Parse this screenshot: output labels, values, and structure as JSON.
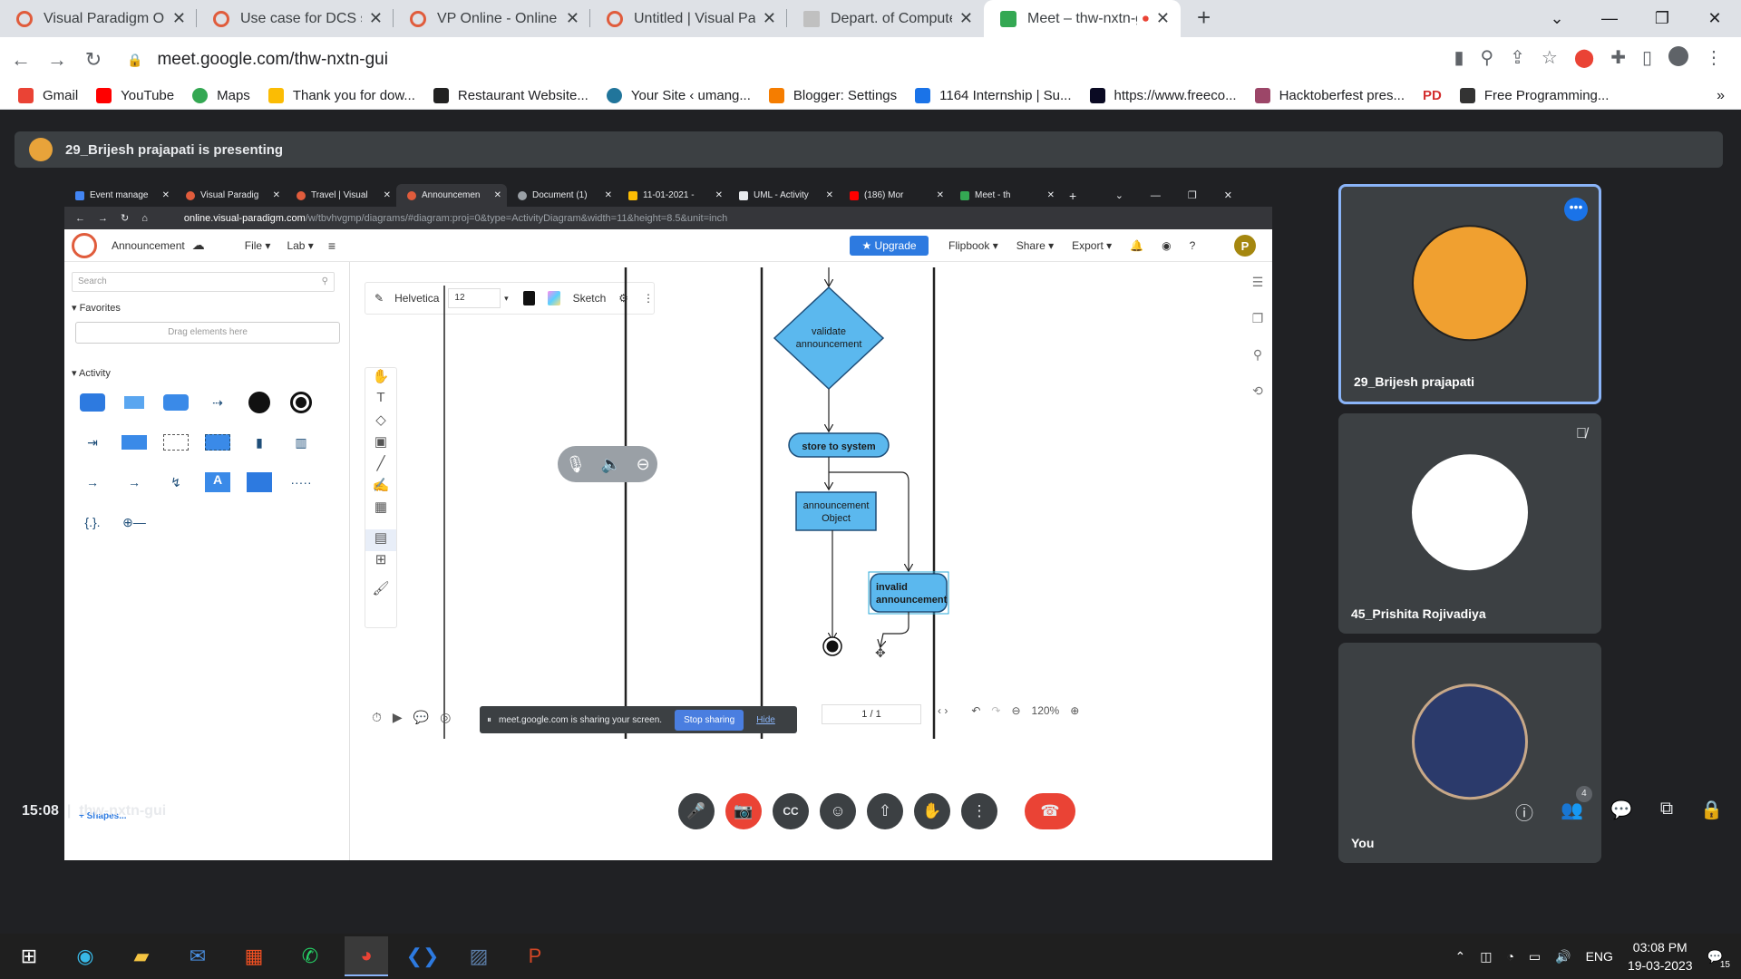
{
  "browser": {
    "tabs": [
      {
        "title": "Visual Paradigm Online",
        "color": "#e05c3c"
      },
      {
        "title": "Use case for DCS site.vpd | ",
        "color": "#e05c3c"
      },
      {
        "title": "VP Online - Online Drawing ",
        "color": "#e05c3c"
      },
      {
        "title": "Untitled | Visual Paradigm C",
        "color": "#e05c3c"
      },
      {
        "title": "Depart. of Computer scienc",
        "color": "#c0c0c0"
      },
      {
        "title": "Meet – thw-nxtn-gui",
        "color": "#34a853"
      }
    ],
    "url": "meet.google.com/thw-nxtn-gui",
    "bookmarks": [
      {
        "label": "Gmail",
        "color": "#ea4335"
      },
      {
        "label": "YouTube",
        "color": "#ff0000"
      },
      {
        "label": "Maps",
        "color": "#34a853"
      },
      {
        "label": "Thank you for dow...",
        "color": "#fbbc04"
      },
      {
        "label": "Restaurant Website...",
        "color": "#222222"
      },
      {
        "label": "Your Site ‹ umang...",
        "color": "#21759b"
      },
      {
        "label": "Blogger: Settings",
        "color": "#f57d00"
      },
      {
        "label": "1164 Internship | Su...",
        "color": "#1a73e8"
      },
      {
        "label": "https://www.freeco...",
        "color": "#0a0a23"
      },
      {
        "label": "Hacktoberfest pres...",
        "color": "#9c4668"
      },
      {
        "label": "PD",
        "color": "#d32f2f"
      },
      {
        "label": "Free Programming...",
        "color": "#333333"
      }
    ]
  },
  "meet": {
    "presenting": "29_Brijesh prajapati is presenting",
    "time": "15:08",
    "code": "thw-nxtn-gui",
    "participant_count": "4",
    "participants": [
      {
        "name": "29_Brijesh prajapati",
        "avatar_color": "#f0a030"
      },
      {
        "name": "45_Prishita Rojivadiya",
        "avatar_color": "#ffffff"
      },
      {
        "name": "You",
        "avatar_color": "#2b3a6b"
      }
    ]
  },
  "shared": {
    "inner_tabs": [
      "Event manage",
      "Visual Paradig",
      "Travel | Visual",
      "Announcemen",
      "Document (1)",
      "11-01-2021 -",
      "UML - Activity",
      "(186) Mor",
      "Meet - th"
    ],
    "inner_url_host": "online.visual-paradigm.com",
    "inner_url_path": "/w/tbvhvgmp/diagrams/#diagram:proj=0&type=ActivityDiagram&width=11&height=8.5&unit=inch",
    "doc_name": "Announcement",
    "menu": {
      "file": "File",
      "lab": "Lab"
    },
    "upgrade": "Upgrade",
    "right_menu": [
      "Flipbook",
      "Share",
      "Export"
    ],
    "avatar_letter": "P",
    "search_placeholder": "Search",
    "favorites": "Favorites",
    "drag_hint": "Drag elements here",
    "activity": "Activity",
    "shapes_link": "+ Shapes...",
    "font_name": "Helvetica",
    "font_size": "12",
    "sketch": "Sketch",
    "diagram": {
      "validate": [
        "validate",
        "announcement"
      ],
      "store": "store to system",
      "object": [
        "announcement",
        "Object"
      ],
      "invalid": [
        "invalid",
        "announcement"
      ]
    },
    "share_note": "meet.google.com is sharing your screen.",
    "stop_sharing": "Stop sharing",
    "hide": "Hide",
    "page": "1 / 1",
    "zoom": "120%"
  },
  "taskbar": {
    "lang": "ENG",
    "time": "03:08 PM",
    "date": "19-03-2023",
    "notif": "15"
  }
}
